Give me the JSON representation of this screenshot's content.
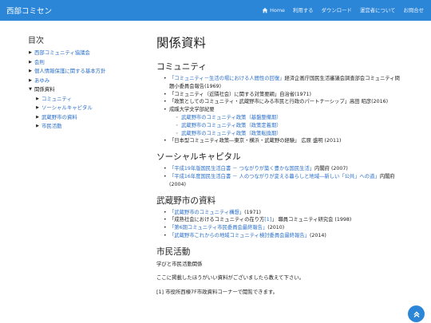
{
  "header": {
    "brand": "西部コミセン",
    "nav": [
      {
        "label": "Home",
        "icon": "home-icon"
      },
      {
        "label": "利用する"
      },
      {
        "label": "ダウンロード"
      },
      {
        "label": "運営者について"
      },
      {
        "label": "お問合せ"
      }
    ]
  },
  "toc": {
    "title": "目次",
    "items": [
      {
        "label": "西部コミュニティ協議会"
      },
      {
        "label": "会則"
      },
      {
        "label": "個人情報保護に関する基本方針"
      },
      {
        "label": "あゆみ"
      },
      {
        "label": "関係資料"
      },
      {
        "label": "コミュニティ"
      },
      {
        "label": "ソーシャルキャピタル"
      },
      {
        "label": "武蔵野市の資料"
      },
      {
        "label": "市民活動"
      }
    ]
  },
  "main": {
    "title": "関係資料",
    "community": {
      "heading": "コミュニティ",
      "items": [
        {
          "link": "「コミュニティ－生活の場における人間性の回復」",
          "rest": "経済企画庁国民生活審議会調査部会コミュニティ問題小委員会報告(1969)"
        },
        {
          "rest": "「コミュニティ（近隣社会）に関する対策要綱」自治省(1971)"
        },
        {
          "rest": "「政策としてのコミュニティ・武蔵野市にみる市民と行政のパートナーシップ」高田 昭彦(2016)"
        },
        {
          "rest": "成蹊大学文学部紀要"
        },
        {
          "rest": "「日本型コミュニティ政策―東京・横浜・武蔵野の経験」 広原 盛明 (2011)"
        }
      ],
      "sub": [
        {
          "label": "武蔵野市のコミュニティ政策（基盤整備期）"
        },
        {
          "label": "武蔵野市のコミュニティ政策（政策定着期）"
        },
        {
          "label": "武蔵野市のコミュニティ政策（政策転換期）"
        }
      ]
    },
    "social": {
      "heading": "ソーシャルキャピタル",
      "items": [
        {
          "link": "「平成19年版国民生活白書 － つながりが築く豊かな国民生活」",
          "rest": "内閣府 (2007)"
        },
        {
          "link": "「平成16年度国民生活白書 － 人のつながりが変える暮らしと地域―新しい「公共」への道」",
          "rest": "内閣府 (2004)"
        }
      ]
    },
    "musashino": {
      "heading": "武蔵野市の資料",
      "items": [
        {
          "link": "「武蔵野市のコミュニティ構想」",
          "rest": "(1971)"
        },
        {
          "pre": "「成熟社会におけるコミュニティの在り方",
          "link": "[1]",
          "rest": "」 職員コミュニティ研究会 (1998)"
        },
        {
          "link": "「第6期コミュニティ市民委員会最終報告」",
          "rest": "(2010)"
        },
        {
          "link": "「武蔵野市これからの地域コミュニティ検討委員会最終報告」",
          "rest": "(2014)"
        }
      ]
    },
    "civic": {
      "heading": "市民活動",
      "line1": "学びと市民活動関係",
      "line2": "ここに掲載したほうがいい資料がございましたら教えて下さい。"
    },
    "footnote": "[1] 市役所西棟7F市政資料コーナーで閲覧できます。"
  },
  "colors": {
    "accent": "#2c86d8",
    "link": "#2a6fc9"
  }
}
